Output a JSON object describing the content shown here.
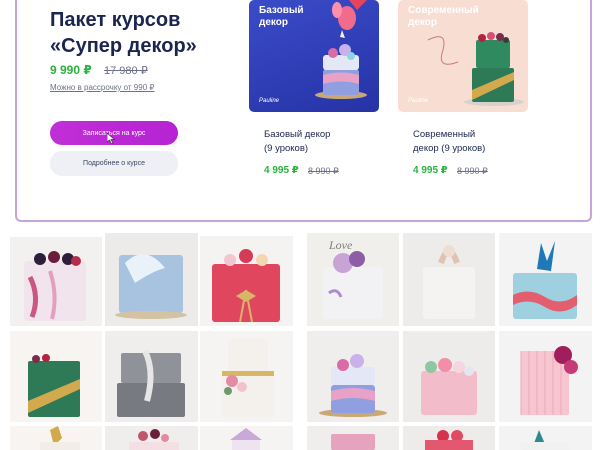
{
  "bundle": {
    "title": "Пакет курсов\n«Супер декор»",
    "price": "9 990 ₽",
    "old_price": "17 980 ₽",
    "installment": "Можно в рассрочку от 990 ₽",
    "enroll_button": "Записаться на курс",
    "details_button": "Подробнее о курсе"
  },
  "courses": [
    {
      "cover_label": "Базовый\nдекор",
      "cover_logo": "Pauline",
      "name": "Базовый декор\n(9 уроков)",
      "price": "4 995 ₽",
      "old_price": "8 990 ₽",
      "cover_color": "#3341bd"
    },
    {
      "cover_label": "Современный\nдекор",
      "cover_logo": "Pauline",
      "name": "Современный\nдекор (9 уроков)",
      "price": "4 995 ₽",
      "old_price": "8 990 ₽",
      "cover_color": "#f8ddd2"
    }
  ],
  "gallery": {
    "left_tiles": [
      "cake-berries-pink",
      "cake-blue-feathers",
      "cake-red-gold-bow",
      "cake-green-gold",
      "cake-grey-ruffle",
      "cake-white-flowers",
      "cake-gold-top",
      "cake-berries-small",
      "cake-carousel"
    ],
    "right_tiles": [
      "cake-love-topper",
      "cake-white-sugar-flowers",
      "cake-blue-waves",
      "cake-pink-unicorn",
      "cake-pink-macarons",
      "cake-magenta-flowers",
      "cake-pink-top",
      "cake-red-top",
      "cake-watercolor"
    ]
  }
}
